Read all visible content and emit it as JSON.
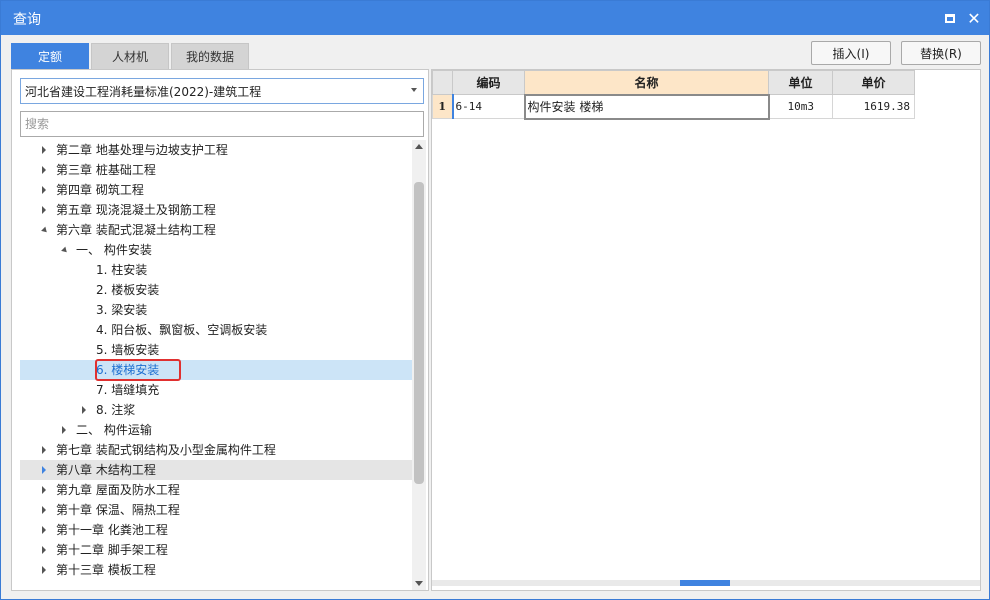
{
  "window": {
    "title": "查询"
  },
  "tabs": [
    {
      "label": "定额",
      "active": true
    },
    {
      "label": "人材机",
      "active": false
    },
    {
      "label": "我的数据",
      "active": false
    }
  ],
  "actions": {
    "insert": "插入(I)",
    "replace": "替换(R)"
  },
  "library": {
    "selected": "河北省建设工程消耗量标准(2022)-建筑工程"
  },
  "search": {
    "placeholder": "搜索",
    "value": ""
  },
  "tree": [
    {
      "label": "第二章 地基处理与边坡支护工程",
      "level": 0,
      "expander": "collapsed"
    },
    {
      "label": "第三章 桩基础工程",
      "level": 0,
      "expander": "collapsed"
    },
    {
      "label": "第四章 砌筑工程",
      "level": 0,
      "expander": "collapsed"
    },
    {
      "label": "第五章 现浇混凝土及钢筋工程",
      "level": 0,
      "expander": "collapsed"
    },
    {
      "label": "第六章 装配式混凝土结构工程",
      "level": 0,
      "expander": "expanded"
    },
    {
      "label": "一、 构件安装",
      "level": 1,
      "expander": "expanded"
    },
    {
      "label": "1. 柱安装",
      "level": 2,
      "expander": "none"
    },
    {
      "label": "2. 楼板安装",
      "level": 2,
      "expander": "none"
    },
    {
      "label": "3. 梁安装",
      "level": 2,
      "expander": "none"
    },
    {
      "label": "4. 阳台板、飘窗板、空调板安装",
      "level": 2,
      "expander": "none"
    },
    {
      "label": "5. 墙板安装",
      "level": 2,
      "expander": "none"
    },
    {
      "label": "6. 楼梯安装",
      "level": 2,
      "expander": "none",
      "selected": true
    },
    {
      "label": "7. 墙缝填充",
      "level": 2,
      "expander": "none"
    },
    {
      "label": "8. 注浆",
      "level": 2,
      "expander": "collapsed"
    },
    {
      "label": "二、 构件运输",
      "level": 1,
      "expander": "collapsed"
    },
    {
      "label": "第七章 装配式钢结构及小型金属构件工程",
      "level": 0,
      "expander": "collapsed"
    },
    {
      "label": "第八章 木结构工程",
      "level": 0,
      "expander": "collapsed",
      "hover": true
    },
    {
      "label": "第九章 屋面及防水工程",
      "level": 0,
      "expander": "collapsed"
    },
    {
      "label": "第十章 保温、隔热工程",
      "level": 0,
      "expander": "collapsed"
    },
    {
      "label": "第十一章 化粪池工程",
      "level": 0,
      "expander": "collapsed"
    },
    {
      "label": "第十二章 脚手架工程",
      "level": 0,
      "expander": "collapsed"
    },
    {
      "label": "第十三章 模板工程",
      "level": 0,
      "expander": "collapsed"
    }
  ],
  "grid": {
    "headers": {
      "code": "编码",
      "name": "名称",
      "unit": "单位",
      "price": "单价"
    },
    "rows": [
      {
        "num": "1",
        "code": "6-14",
        "name": "构件安装 楼梯",
        "unit": "10m3",
        "price": "1619.38"
      }
    ]
  },
  "colors": {
    "accent": "#3f83e0",
    "highlight": "#e03030",
    "selected_bg": "#cce4f7"
  }
}
